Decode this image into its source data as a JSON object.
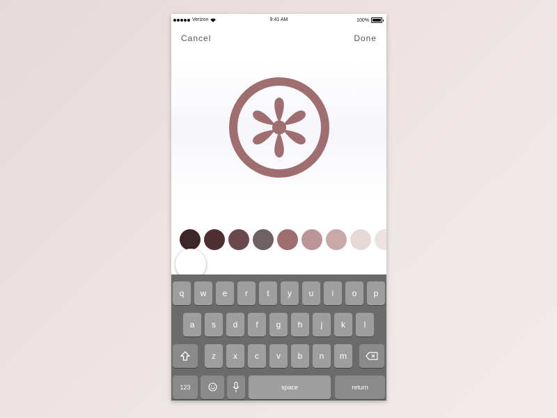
{
  "status_bar": {
    "carrier": "Verizon",
    "time": "9:41 AM",
    "battery": "100%"
  },
  "nav": {
    "cancel_label": "Cancel",
    "done_label": "Done"
  },
  "icon": {
    "name": "asterisk-icon",
    "color": "#9e6e70"
  },
  "swatches": [
    {
      "color": "#3d2629"
    },
    {
      "color": "#4e3034"
    },
    {
      "color": "#6b484d"
    },
    {
      "color": "#6f6161"
    },
    {
      "color": "#9e6e70"
    },
    {
      "color": "#bb9599"
    },
    {
      "color": "#c9a8aa"
    },
    {
      "color": "#e6d9d8"
    },
    {
      "color": "#ece3e2"
    }
  ],
  "selected_swatch": {
    "color": "#ffffff"
  },
  "keyboard": {
    "row1": [
      "q",
      "w",
      "e",
      "r",
      "t",
      "y",
      "u",
      "i",
      "o",
      "p"
    ],
    "row2": [
      "a",
      "s",
      "d",
      "f",
      "g",
      "h",
      "j",
      "k",
      "l"
    ],
    "row3": [
      "z",
      "x",
      "c",
      "v",
      "b",
      "n",
      "m"
    ],
    "numbers_label": "123",
    "space_label": "space",
    "return_label": "return",
    "shift_icon": "shift-icon",
    "delete_icon": "delete-icon",
    "emoji_icon": "emoji-icon",
    "mic_icon": "microphone-icon"
  }
}
